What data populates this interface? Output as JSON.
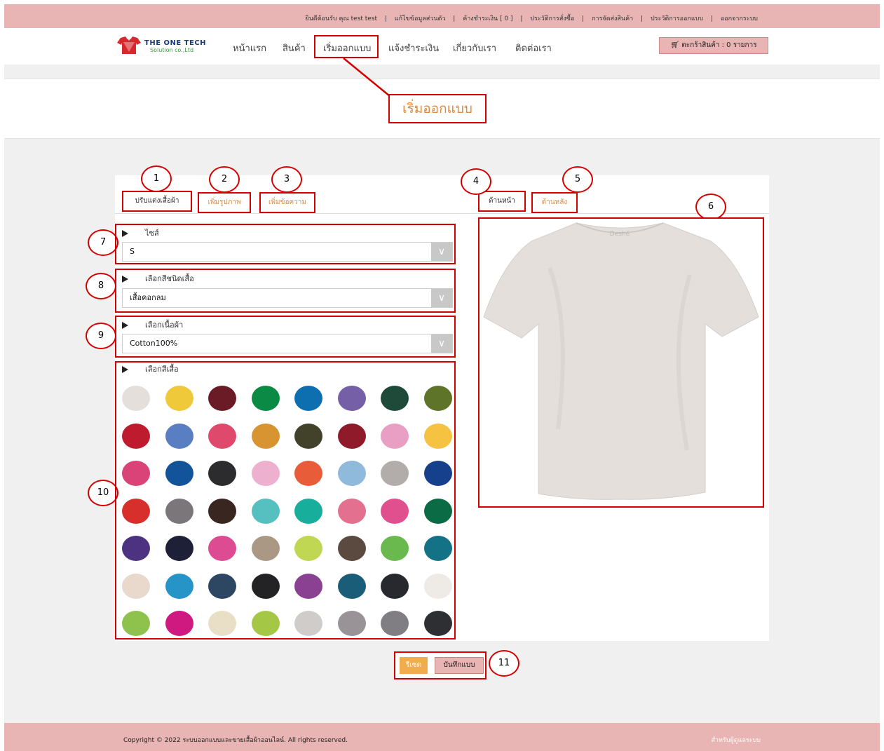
{
  "topbar": {
    "links": [
      "ยินดีต้อนรับ คุณ test test",
      "|",
      "แก้ไขข้อมูลส่วนตัว",
      "|",
      "ค้างชำระเงิน [ 0 ]",
      "|",
      "ประวัติการสั่งซื้อ",
      "|",
      "การจัดส่งสินค้า",
      "|",
      "ประวัติการออกแบบ",
      "|",
      "ออกจากระบบ"
    ]
  },
  "brand": {
    "line1": "THE ONE TECH",
    "line2": "Solution co.,Ltd"
  },
  "nav": {
    "items": [
      "หน้าแรก",
      "สินค้า",
      "เริ่มออกแบบ",
      "แจ้งชำระเงิน",
      "เกี่ยวกับเรา",
      "ติดต่อเรา"
    ],
    "cart": "ตะกร้าสินค้า : 0 รายการ"
  },
  "page_title": "เริ่มออกแบบ",
  "tabs": {
    "customize": "ปรับแต่งเสื้อผ้า",
    "add_image": "เพิ่มรูปภาพ",
    "add_text": "เพิ่มข้อความ",
    "front": "ด้านหน้า",
    "back": "ด้านหลัง"
  },
  "callouts": [
    "1",
    "2",
    "3",
    "4",
    "5",
    "6",
    "7",
    "8",
    "9",
    "10",
    "11"
  ],
  "size": {
    "label": "ไซส์",
    "value": "S"
  },
  "shirt_type": {
    "label": "เลือกสีชนิดเสื้อ",
    "value": "เสื้อคอกลม"
  },
  "fabric": {
    "label": "เลือกเนื้อผ้า",
    "value": "Cotton100%"
  },
  "colors": {
    "label": "เลือกสีเสื้อ",
    "swatches": [
      "#e4dfdb",
      "#f0c93a",
      "#6b1b25",
      "#0b8a45",
      "#0e6fb0",
      "#7560a8",
      "#1f4a3a",
      "#5e7428",
      "#bf1b2e",
      "#5a7ec2",
      "#df4a6c",
      "#d99432",
      "#42412a",
      "#8e1a2a",
      "#e99fc4",
      "#f5c242",
      "#d94378",
      "#13539a",
      "#2c2c2e",
      "#eeb0cf",
      "#e85c3a",
      "#8fbadc",
      "#b2adab",
      "#163f8c",
      "#d62f2c",
      "#7a767a",
      "#3a2620",
      "#56bfc0",
      "#18ae9c",
      "#e3708e",
      "#e04f8e",
      "#0b6b44",
      "#4e3282",
      "#1e2038",
      "#dd4c92",
      "#ab9884",
      "#c0d754",
      "#5a4a40",
      "#6ab94f",
      "#147286",
      "#e8d9cc",
      "#2794c8",
      "#2d4763",
      "#232325",
      "#8a4191",
      "#1a5d79",
      "#27292f",
      "#eeebe6",
      "#8fc24c",
      "#d01980",
      "#e8dfc6",
      "#a4c846",
      "#d0ccca",
      "#999398",
      "#807e82",
      "#2d2f33"
    ]
  },
  "shirt_preview": {
    "color": "#e4dfdb",
    "tag": "Deshé"
  },
  "buttons": {
    "reset": "รีเซต",
    "save": "บันทึกแบบ"
  },
  "footer": {
    "copyright": "Copyright © 2022 ระบบออกแบบและขายเสื้อผ้าออนไลน์. All rights reserved.",
    "admin": "สำหรับผู้ดูแลระบบ"
  }
}
